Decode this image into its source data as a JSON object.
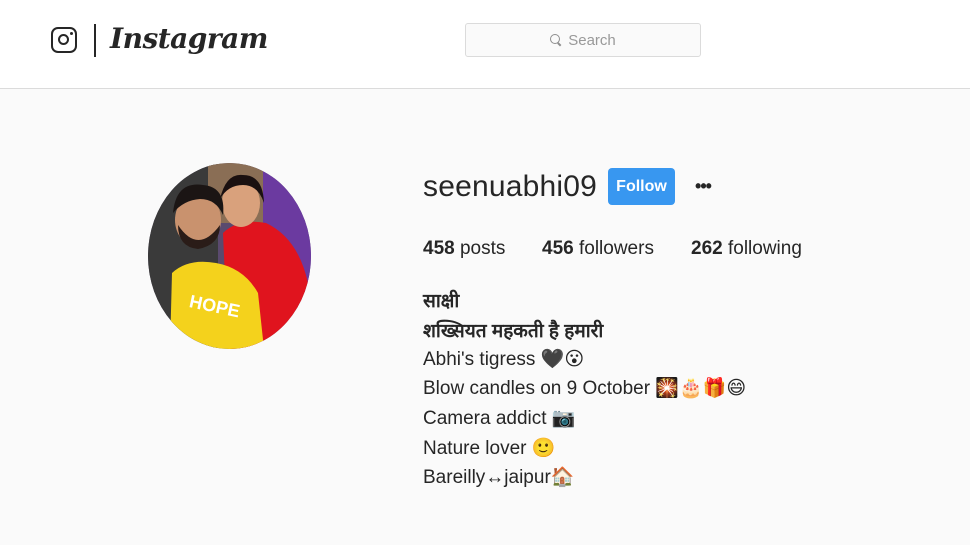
{
  "header": {
    "wordmark": "Instagram",
    "search_placeholder": "Search"
  },
  "profile": {
    "username": "seenuabhi09",
    "follow_label": "Follow",
    "more_label": "•••",
    "stats": {
      "posts_count": "458",
      "posts_label": " posts",
      "followers_count": "456",
      "followers_label": " followers",
      "following_count": "262",
      "following_label": " following"
    },
    "bio": {
      "name": "साक्षी",
      "line1": "शख्सियत महकती है हमारी",
      "line2": "Abhi's tigress 🖤😮",
      "line3": "Blow candles on 9 October 🎇🎂🎁😄",
      "line4": "Camera addict 📷",
      "line5": "Nature lover 🙂",
      "line6": "Bareilly↔jaipur🏠"
    }
  },
  "colors": {
    "follow_button": "#3897f0",
    "background": "#fafafa",
    "text": "#262626"
  }
}
